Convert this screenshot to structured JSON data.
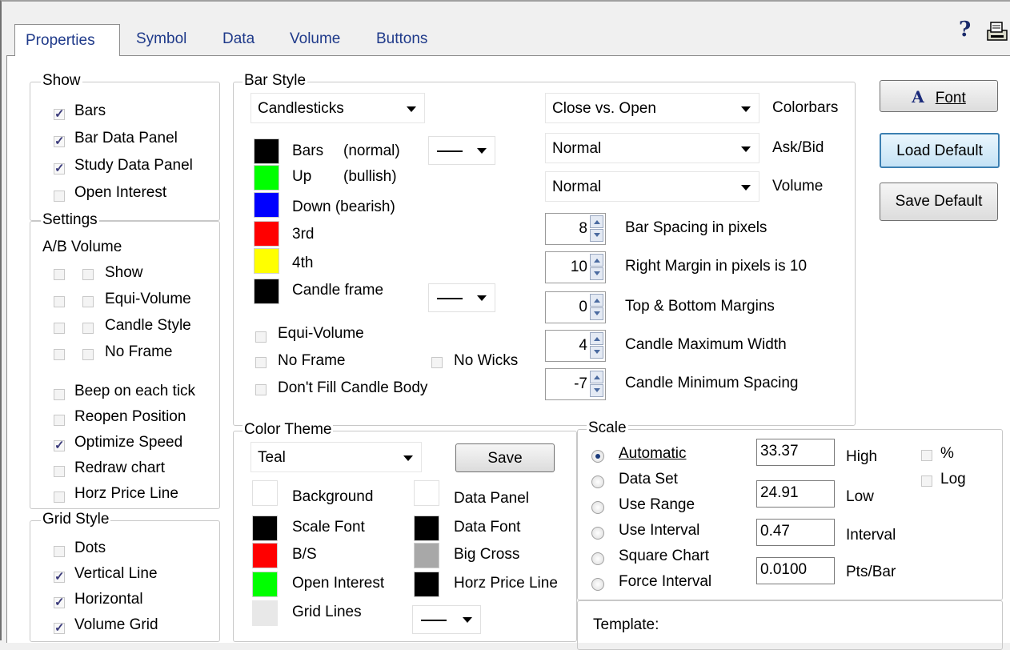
{
  "tabs": [
    "Properties",
    "Symbol",
    "Data",
    "Volume",
    "Buttons"
  ],
  "toolbar": {
    "help_glyph": "?"
  },
  "show": {
    "title": "Show",
    "items": [
      {
        "label": "Bars",
        "checked": true
      },
      {
        "label": "Bar Data Panel",
        "checked": true
      },
      {
        "label": "Study Data Panel",
        "checked": true
      },
      {
        "label": "Open Interest",
        "checked": false
      }
    ]
  },
  "settings": {
    "title": "Settings",
    "header": "A/B  Volume",
    "pairs": [
      "Show",
      "Equi-Volume",
      "Candle Style",
      "No Frame"
    ],
    "items": [
      {
        "label": "Beep on each tick",
        "checked": false
      },
      {
        "label": "Reopen Position",
        "checked": false
      },
      {
        "label": "Optimize Speed",
        "checked": true
      },
      {
        "label": "Redraw chart",
        "checked": false
      },
      {
        "label": "Horz Price Line",
        "checked": false
      }
    ]
  },
  "grid_style": {
    "title": "Grid Style",
    "items": [
      {
        "label": "Dots",
        "checked": false
      },
      {
        "label": "Vertical Line",
        "checked": true
      },
      {
        "label": "Horizontal",
        "checked": true
      },
      {
        "label": "Volume Grid",
        "checked": true
      }
    ]
  },
  "bar_style": {
    "title": "Bar Style",
    "style_value": "Candlesticks",
    "swatches": [
      {
        "label": "Bars",
        "note": "(normal)",
        "color": "#000000"
      },
      {
        "label": "Up",
        "note": "(bullish)",
        "color": "#00ff00"
      },
      {
        "label": "Down (bearish)",
        "note": "",
        "color": "#0000ff"
      },
      {
        "label": "3rd",
        "note": "",
        "color": "#ff0000"
      },
      {
        "label": "4th",
        "note": "",
        "color": "#ffff00"
      },
      {
        "label": "Candle frame",
        "note": "",
        "color": "#000000"
      }
    ],
    "equi_volume": "Equi-Volume",
    "no_frame": "No Frame",
    "no_wicks": "No Wicks",
    "dont_fill": "Don't Fill Candle Body",
    "colorbars_value": "Close vs. Open",
    "colorbars_label": "Colorbars",
    "askbid_value": "Normal",
    "askbid_label": "Ask/Bid",
    "volume_value": "Normal",
    "volume_label": "Volume",
    "spinners": [
      {
        "value": "8",
        "label": "Bar Spacing in pixels"
      },
      {
        "value": "10",
        "label": "Right Margin in pixels is 10"
      },
      {
        "value": "0",
        "label": "Top & Bottom Margins"
      },
      {
        "value": "4",
        "label": "Candle Maximum Width"
      },
      {
        "value": "-7",
        "label": "Candle Minimum Spacing"
      }
    ]
  },
  "buttons": {
    "font": "Font",
    "font_glyph": "A",
    "load_default": "Load Default",
    "save_default": "Save Default"
  },
  "color_theme": {
    "title": "Color Theme",
    "value": "Teal",
    "save": "Save",
    "left": [
      {
        "label": "Background",
        "color": "#ffffff"
      },
      {
        "label": "Scale Font",
        "color": "#000000"
      },
      {
        "label": "B/S",
        "color": "#ff0000"
      },
      {
        "label": "Open Interest",
        "color": "#00ff00"
      },
      {
        "label": "Grid Lines",
        "color": "#e8e8e8"
      }
    ],
    "right": [
      {
        "label": "Data Panel",
        "color": "#ffffff"
      },
      {
        "label": "Data Font",
        "color": "#000000"
      },
      {
        "label": "Big Cross",
        "color": "#a8a8a8"
      },
      {
        "label": "Horz Price Line",
        "color": "#000000"
      }
    ]
  },
  "scale": {
    "title": "Scale",
    "options": [
      "Automatic",
      "Data Set",
      "Use Range",
      "Use Interval",
      "Square Chart",
      "Force Interval"
    ],
    "selected": "Automatic",
    "fields": [
      {
        "value": "33.37",
        "label": "High"
      },
      {
        "value": "24.91",
        "label": "Low"
      },
      {
        "value": "0.47",
        "label": "Interval"
      },
      {
        "value": "0.0100",
        "label": "Pts/Bar"
      }
    ],
    "pct_label": "%",
    "log_label": "Log"
  },
  "template": {
    "label": "Template:"
  }
}
